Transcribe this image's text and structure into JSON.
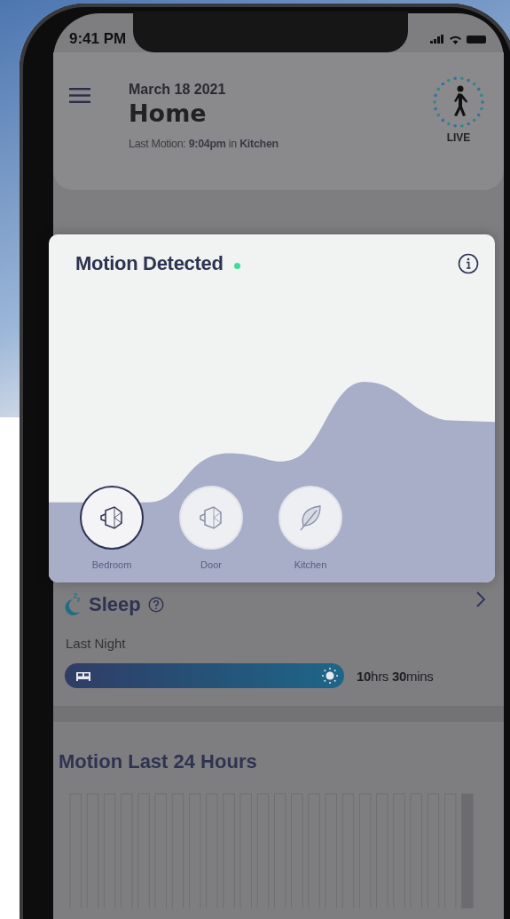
{
  "status_bar": {
    "time": "9:41 PM"
  },
  "header": {
    "date": "March 18 2021",
    "title": "Home",
    "last_motion": "Last Motion: **9:04pm** in **Kitchen**",
    "live_label": "LIVE"
  },
  "motion_card": {
    "title": "Motion Detected",
    "active": true,
    "sensors": [
      {
        "label": "Bedroom",
        "kind": "motion",
        "selected": true
      },
      {
        "label": "Door",
        "kind": "motion",
        "selected": false
      },
      {
        "label": "Kitchen",
        "kind": "plant",
        "selected": false
      }
    ]
  },
  "sleep": {
    "title": "Sleep",
    "period": "Last Night",
    "duration": "**10**hrs **30**mins"
  },
  "motion_24h": {
    "title": "Motion Last 24 Hours"
  }
}
